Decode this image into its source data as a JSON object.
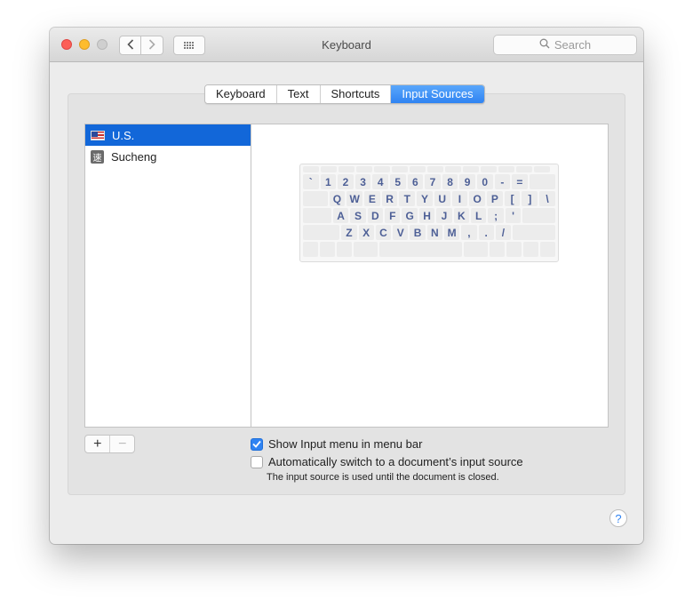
{
  "window": {
    "title": "Keyboard",
    "search_placeholder": "Search",
    "icons": [
      "back-chevron-icon",
      "forward-chevron-icon",
      "grid-icon",
      "search-icon"
    ]
  },
  "tabs": [
    {
      "label": "Keyboard",
      "active": false
    },
    {
      "label": "Text",
      "active": false
    },
    {
      "label": "Shortcuts",
      "active": false
    },
    {
      "label": "Input Sources",
      "active": true
    }
  ],
  "input_sources": [
    {
      "label": "U.S.",
      "icon": "us-flag-icon",
      "selected": true
    },
    {
      "label": "Sucheng",
      "icon": "sucheng-icon",
      "icon_glyph": "速",
      "selected": false
    }
  ],
  "keyboard_rows": [
    [
      "`",
      "1",
      "2",
      "3",
      "4",
      "5",
      "6",
      "7",
      "8",
      "9",
      "0",
      "-",
      "="
    ],
    [
      "Q",
      "W",
      "E",
      "R",
      "T",
      "Y",
      "U",
      "I",
      "O",
      "P",
      "[",
      "]",
      "\\"
    ],
    [
      "A",
      "S",
      "D",
      "F",
      "G",
      "H",
      "J",
      "K",
      "L",
      ";",
      "'"
    ],
    [
      "Z",
      "X",
      "C",
      "V",
      "B",
      "N",
      "M",
      ",",
      ".",
      "/"
    ]
  ],
  "buttons": {
    "add": "+",
    "remove": "−",
    "help": "?"
  },
  "options": {
    "show_input_menu": {
      "label": "Show Input menu in menu bar",
      "checked": true
    },
    "auto_switch": {
      "label": "Automatically switch to a document’s input source",
      "checked": false
    },
    "note": "The input source is used until the document is closed."
  },
  "colors": {
    "accent": "#2f83f2",
    "selection": "#1267d9"
  }
}
